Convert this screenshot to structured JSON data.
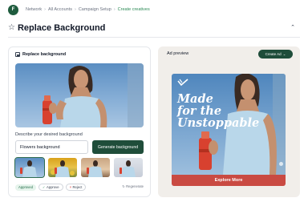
{
  "avatar": {
    "initial": "F"
  },
  "breadcrumb": [
    "Network",
    "All Accounts",
    "Campaign Setup",
    "Create creatives"
  ],
  "page": {
    "title": "Replace Background",
    "collapse_icon": "chevron-up-icon"
  },
  "left_panel": {
    "header": "Replace background",
    "describe_label": "Describe your desired background",
    "input_value": "Flowers background",
    "generate_label": "Generate background",
    "thumbnails": [
      {
        "name": "blue-sky",
        "selected": true
      },
      {
        "name": "flowers",
        "selected": false
      },
      {
        "name": "wood",
        "selected": false
      },
      {
        "name": "light-studio",
        "selected": false
      }
    ],
    "status": {
      "approved": "Approved",
      "approve": "Approve",
      "reject": "Reject",
      "regenerate": "Regenerate"
    }
  },
  "right_panel": {
    "label": "Ad preview",
    "create_ad": "Create Ad",
    "headline_lines": [
      "Made",
      "for the",
      "Unstoppable"
    ],
    "cta": "Explore More"
  },
  "colors": {
    "brand_dark": "#1f4d3a",
    "cta_red": "#c94a42",
    "sky": "#5b8ec2",
    "active_crumb": "#2e8b57"
  }
}
